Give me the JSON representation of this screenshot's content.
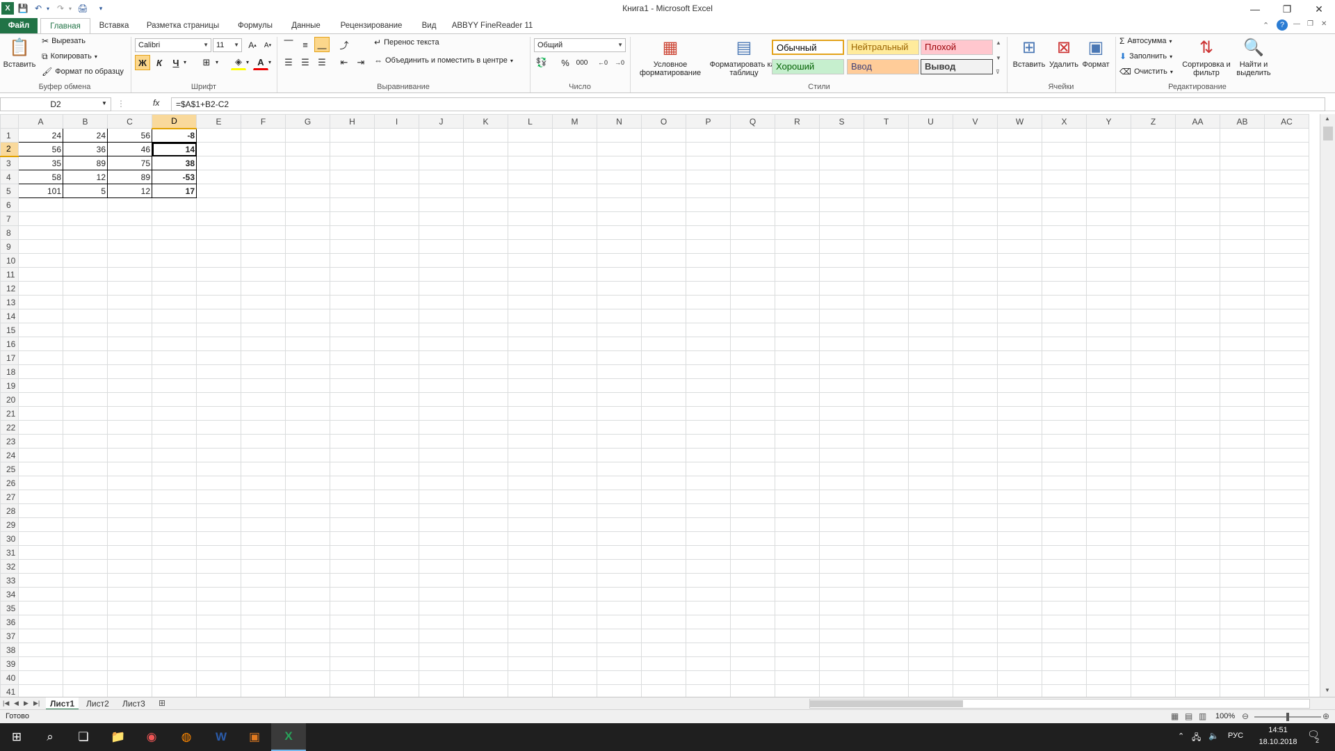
{
  "window": {
    "title": "Книга1 - Microsoft Excel"
  },
  "ribbon_tabs": [
    "Файл",
    "Главная",
    "Вставка",
    "Разметка страницы",
    "Формулы",
    "Данные",
    "Рецензирование",
    "Вид",
    "ABBYY FineReader 11"
  ],
  "clipboard": {
    "paste": "Вставить",
    "cut": "Вырезать",
    "copy": "Копировать",
    "format_painter": "Формат по образцу",
    "label": "Буфер обмена"
  },
  "font": {
    "name": "Calibri",
    "size": "11",
    "bold": "Ж",
    "italic": "К",
    "underline": "Ч",
    "label": "Шрифт"
  },
  "alignment": {
    "wrap": "Перенос текста",
    "merge": "Объединить и поместить в центре",
    "label": "Выравнивание"
  },
  "number": {
    "format": "Общий",
    "label": "Число"
  },
  "styles": {
    "conditional": "Условное форматирование",
    "as_table": "Форматировать как таблицу",
    "normal": "Обычный",
    "neutral": "Нейтральный",
    "bad": "Плохой",
    "good": "Хороший",
    "input": "Ввод",
    "output": "Вывод",
    "label": "Стили"
  },
  "cells": {
    "insert": "Вставить",
    "delete": "Удалить",
    "format": "Формат",
    "label": "Ячейки"
  },
  "editing": {
    "autosum": "Автосумма",
    "fill": "Заполнить",
    "clear": "Очистить",
    "sort": "Сортировка и фильтр",
    "find": "Найти и выделить",
    "label": "Редактирование"
  },
  "formula_bar": {
    "name_box": "D2",
    "fx": "fx",
    "formula": "=$A$1+B2-C2"
  },
  "columns": [
    "A",
    "B",
    "C",
    "D",
    "E",
    "F",
    "G",
    "H",
    "I",
    "J",
    "K",
    "L",
    "M",
    "N",
    "O",
    "P",
    "Q",
    "R",
    "S",
    "T",
    "U",
    "V",
    "W",
    "X",
    "Y",
    "Z",
    "AA",
    "AB",
    "AC"
  ],
  "rows": [
    [
      "24",
      "24",
      "56",
      "-8"
    ],
    [
      "56",
      "36",
      "46",
      "14"
    ],
    [
      "35",
      "89",
      "75",
      "38"
    ],
    [
      "58",
      "12",
      "89",
      "-53"
    ],
    [
      "101",
      "5",
      "12",
      "17"
    ]
  ],
  "row_count": 41,
  "sheets": [
    "Лист1",
    "Лист2",
    "Лист3"
  ],
  "status": {
    "ready": "Готово",
    "zoom": "100%"
  },
  "taskbar": {
    "lang": "РУС",
    "time": "14:51",
    "date": "18.10.2018",
    "notif_count": "2"
  },
  "colors": {
    "excel_green": "#217346",
    "active_header": "#f9d99b"
  }
}
